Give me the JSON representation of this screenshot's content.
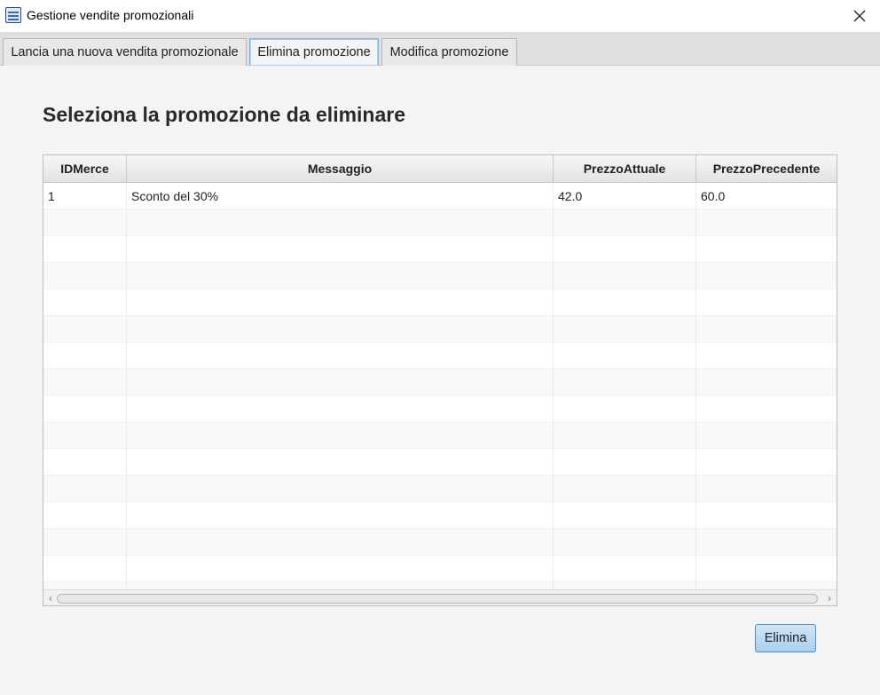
{
  "window": {
    "title": "Gestione vendite promozionali",
    "close_glyph": "✕",
    "icon": "app-icon"
  },
  "tabs": [
    {
      "label": "Lancia una nuova vendita promozionale",
      "active": false
    },
    {
      "label": "Elimina promozione",
      "active": true
    },
    {
      "label": "Modifica promozione",
      "active": false
    }
  ],
  "main": {
    "heading": "Seleziona la promozione da eliminare"
  },
  "table": {
    "columns": [
      "IDMerce",
      "Messaggio",
      "PrezzoAttuale",
      "PrezzoPrecedente"
    ],
    "rows": [
      {
        "IDMerce": "1",
        "Messaggio": "Sconto del 30%",
        "PrezzoAttuale": "42.0",
        "PrezzoPrecedente": "60.0"
      }
    ]
  },
  "scrollbar": {
    "left_arrow": "‹",
    "right_arrow": "›"
  },
  "actions": {
    "delete_label": "Elimina"
  },
  "colors": {
    "accent": "#a9d0ee",
    "accent_border": "#4f8fc4",
    "background": "#f4f4f4"
  }
}
